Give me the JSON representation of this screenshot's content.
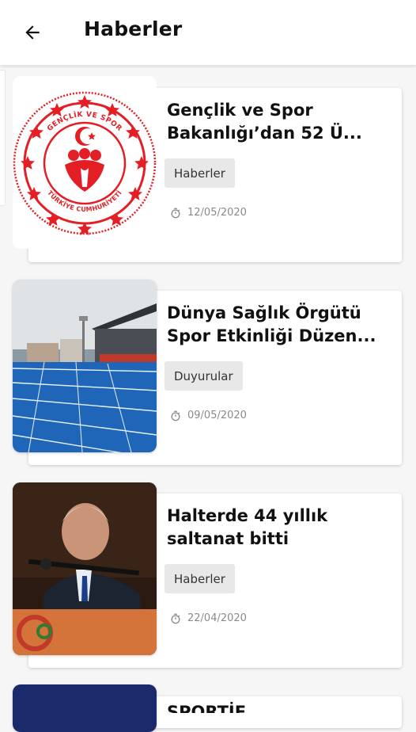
{
  "header": {
    "title": "Haberler",
    "back_icon": "arrow-left-icon"
  },
  "articles": [
    {
      "title": "Gençlik ve Spor\nBakanlığı’dan 52 Ü...",
      "category": "Haberler",
      "date": "12/05/2020",
      "logo_text": "TÜRKİYE CUMHURİYETİ GENÇLİK VE SPOR BAKANLIĞI"
    },
    {
      "title": "Dünya Sağlık Örgütü\nSpor Etkinliği Düzen...",
      "category": "Duyurular",
      "date": "09/05/2020"
    },
    {
      "title": "Halterde 44 yıllık\nsaltanat bitti",
      "category": "Haberler",
      "date": "22/04/2020"
    },
    {
      "title": "SPORTİF..."
    }
  ],
  "colors": {
    "brand_red": "#e31e24",
    "track_blue": "#1f66b8"
  }
}
